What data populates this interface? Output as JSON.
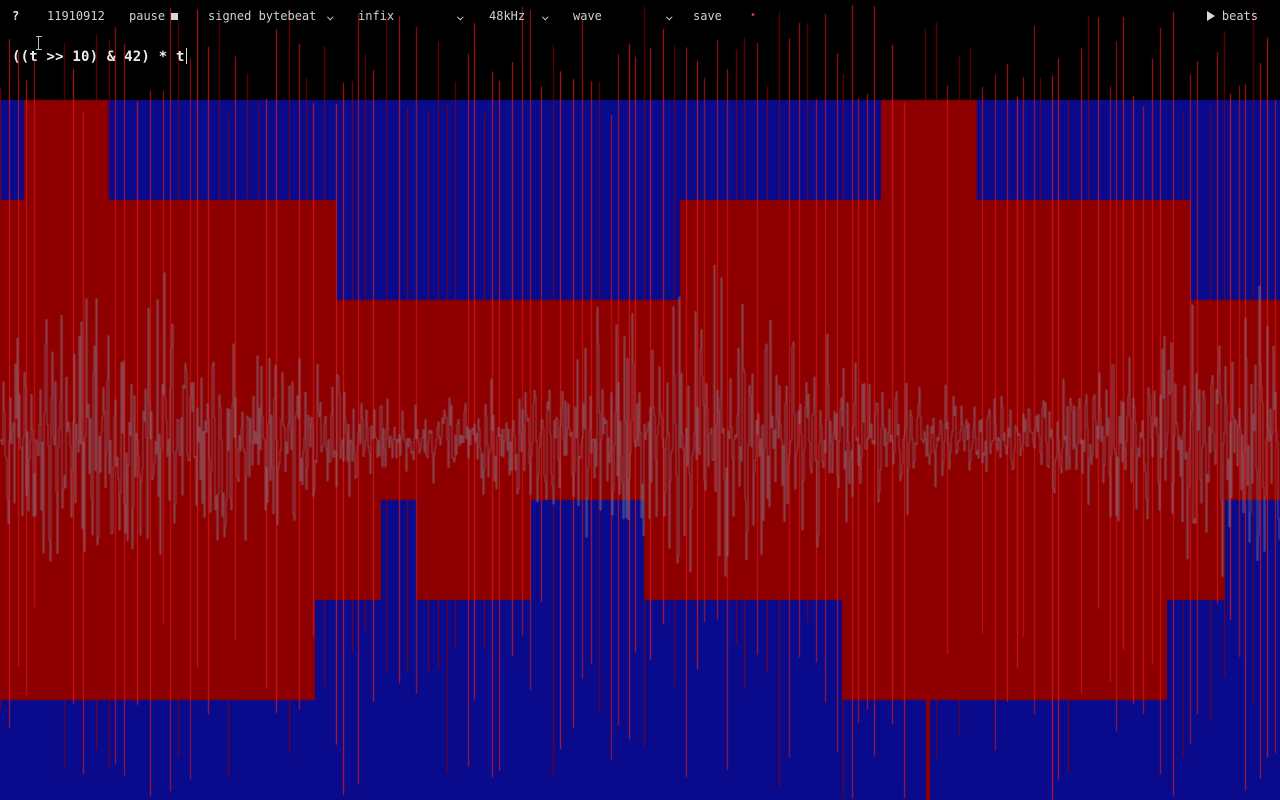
{
  "topbar": {
    "help_label": "?",
    "counter": "11910912",
    "pause_label": "pause",
    "mode": {
      "selected": "signed bytebeat"
    },
    "syntax": {
      "selected": "infix"
    },
    "rate": {
      "selected": "48kHz"
    },
    "view": {
      "selected": "wave"
    },
    "save_label": "save",
    "indicator_glyph": "•",
    "beats_label": "beats"
  },
  "editor": {
    "expression": "((t >> 10) & 42) * t"
  },
  "icons": {
    "pause": "stop-square-icon",
    "beats": "play-triangle-icon",
    "dropdown": "chevron-down-icon"
  },
  "colors": {
    "background": "#000000",
    "fill_blue": "#0a0a8c",
    "wave_red": "#8e0000",
    "spike_red": "#d81a1a",
    "trace_gray": "#8a8aa0",
    "text": "#d8d8d8"
  }
}
